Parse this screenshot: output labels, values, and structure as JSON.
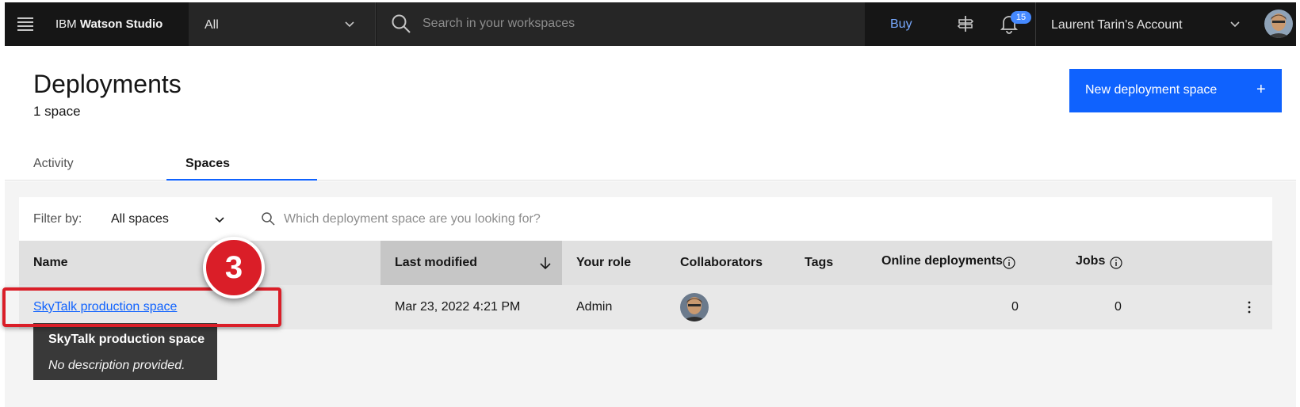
{
  "header": {
    "brand_prefix": "IBM",
    "brand_name": "Watson Studio",
    "context_value": "All",
    "search_placeholder": "Search in your workspaces",
    "buy_label": "Buy",
    "notification_count": "15",
    "account_name": "Laurent Tarin's Account"
  },
  "page": {
    "title": "Deployments",
    "subtitle": "1 space",
    "new_button_label": "New deployment space",
    "new_button_icon": "+"
  },
  "tabs": [
    {
      "label": "Activity",
      "active": false
    },
    {
      "label": "Spaces",
      "active": true
    }
  ],
  "toolbar": {
    "filter_label": "Filter by:",
    "filter_value": "All spaces",
    "search_placeholder": "Which deployment space are you looking for?"
  },
  "table": {
    "columns": [
      "Name",
      "Last modified",
      "Your role",
      "Collaborators",
      "Tags",
      "Online deployments",
      "Jobs"
    ],
    "sorted_column": "Last modified",
    "rows": [
      {
        "name": "SkyTalk production space",
        "last_modified": "Mar 23, 2022 4:21 PM",
        "role": "Admin",
        "tags": "",
        "online_deployments": "0",
        "jobs": "0"
      }
    ]
  },
  "tooltip": {
    "title": "SkyTalk production space",
    "description": "No description provided."
  },
  "annotation": {
    "step": "3"
  },
  "colors": {
    "header_bg": "#161616",
    "primary": "#0f62fe",
    "link": "#0f62fe",
    "annotation_red": "#da1e28"
  }
}
